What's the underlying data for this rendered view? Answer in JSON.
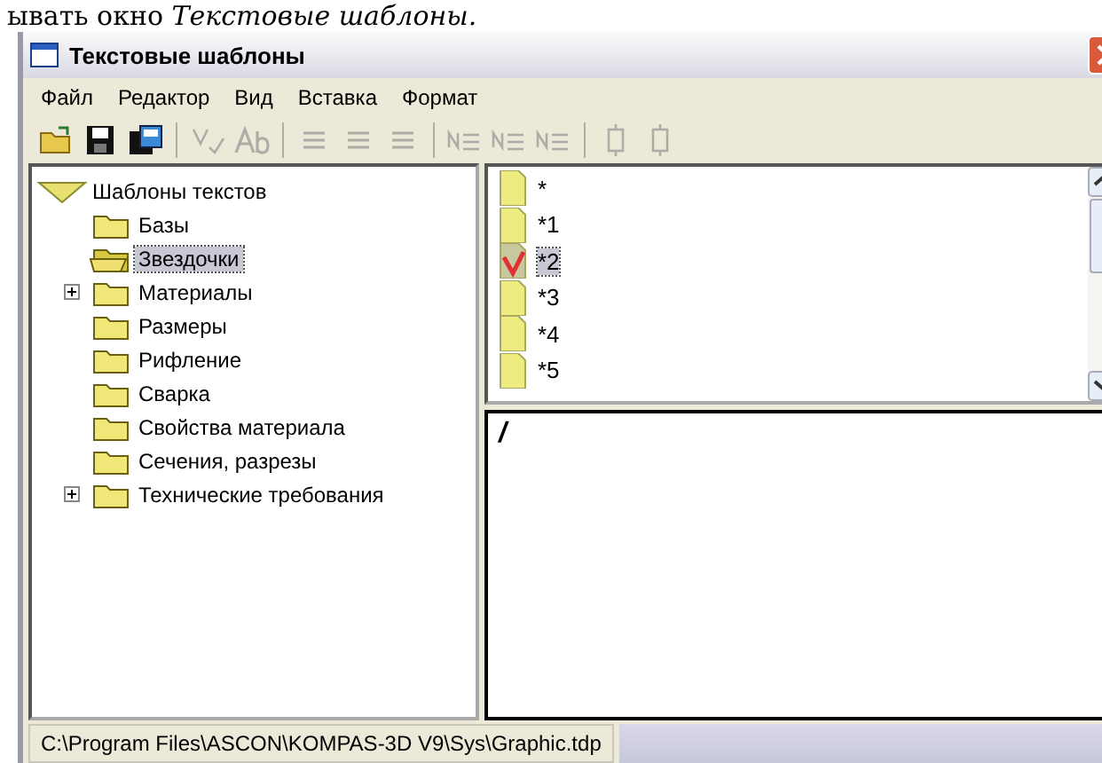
{
  "caption": "ывать окно *Текстовые шаблоны.*",
  "window": {
    "title": "Текстовые шаблоны"
  },
  "menu": [
    "Файл",
    "Редактор",
    "Вид",
    "Вставка",
    "Формат"
  ],
  "toolbar": [
    {
      "kind": "open",
      "disabled": false
    },
    {
      "kind": "save",
      "disabled": false
    },
    {
      "kind": "saveas",
      "disabled": false
    },
    {
      "kind": "sep"
    },
    {
      "kind": "spell",
      "disabled": true
    },
    {
      "kind": "ab",
      "disabled": true
    },
    {
      "kind": "sep"
    },
    {
      "kind": "al1",
      "disabled": true
    },
    {
      "kind": "al2",
      "disabled": true
    },
    {
      "kind": "al3",
      "disabled": true
    },
    {
      "kind": "sep"
    },
    {
      "kind": "n1",
      "disabled": true
    },
    {
      "kind": "n2",
      "disabled": true
    },
    {
      "kind": "n3",
      "disabled": true
    },
    {
      "kind": "sep"
    },
    {
      "kind": "v1",
      "disabled": true
    },
    {
      "kind": "v2",
      "disabled": true
    }
  ],
  "tree": {
    "label": "Шаблоны текстов",
    "expanded": true,
    "children": [
      {
        "label": "Базы",
        "kind": "leaf",
        "selected": false
      },
      {
        "label": "Звездочки",
        "kind": "leaf",
        "selected": true
      },
      {
        "label": "Материалы",
        "kind": "group",
        "selected": false
      },
      {
        "label": "Размеры",
        "kind": "leaf",
        "selected": false
      },
      {
        "label": "Рифление",
        "kind": "leaf",
        "selected": false
      },
      {
        "label": "Сварка",
        "kind": "leaf",
        "selected": false
      },
      {
        "label": "Свойства материала",
        "kind": "leaf",
        "selected": false
      },
      {
        "label": "Сечения, разрезы",
        "kind": "leaf",
        "selected": false
      },
      {
        "label": "Технические требования",
        "kind": "group",
        "selected": false
      }
    ]
  },
  "templates": [
    {
      "label": "*",
      "selected": false
    },
    {
      "label": "*1",
      "selected": false
    },
    {
      "label": "*2",
      "selected": true
    },
    {
      "label": "*3",
      "selected": false
    },
    {
      "label": "*4",
      "selected": false
    },
    {
      "label": "*5",
      "selected": false
    }
  ],
  "editor": {
    "value": "/"
  },
  "status_bar": {
    "path": "C:\\Program Files\\ASCON\\KOMPAS-3D V9\\Sys\\Graphic.tdp"
  }
}
